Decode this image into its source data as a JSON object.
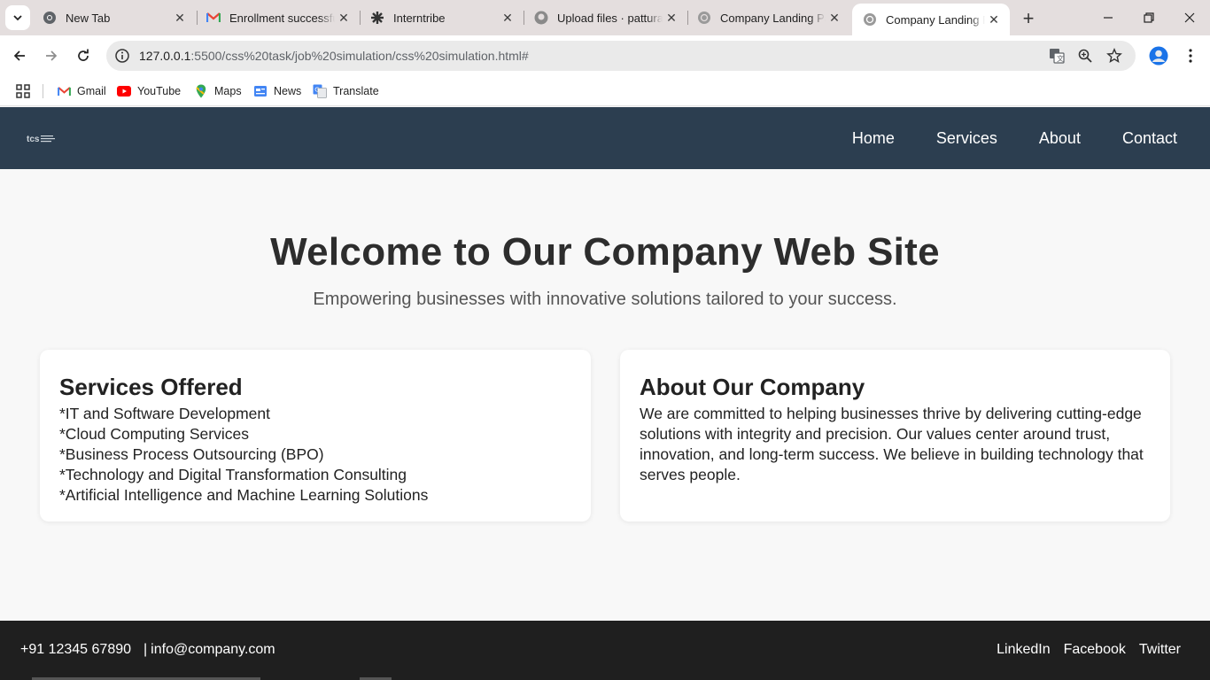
{
  "browser": {
    "tabs": [
      {
        "title": "New Tab",
        "icon": "chrome-icon"
      },
      {
        "title": "Enrollment successful",
        "icon": "gmail-icon"
      },
      {
        "title": "Interntribe",
        "icon": "interntribe-icon"
      },
      {
        "title": "Upload files · patturaj",
        "icon": "github-icon"
      },
      {
        "title": "Company Landing Page",
        "icon": "globe-icon"
      },
      {
        "title": "Company Landing Page",
        "icon": "globe-icon",
        "active": true
      }
    ],
    "url_host": "127.0.0.1",
    "url_rest": ":5500/css%20task/job%20simulation/css%20simulation.html#",
    "bookmarks": [
      {
        "label": "Gmail",
        "icon": "gmail-icon"
      },
      {
        "label": "YouTube",
        "icon": "youtube-icon"
      },
      {
        "label": "Maps",
        "icon": "maps-icon"
      },
      {
        "label": "News",
        "icon": "news-icon"
      },
      {
        "label": "Translate",
        "icon": "translate-icon"
      }
    ]
  },
  "header": {
    "nav": [
      "Home",
      "Services",
      "About",
      "Contact"
    ]
  },
  "hero": {
    "title": "Welcome to Our Company Web Site",
    "subtitle": "Empowering businesses with innovative solutions tailored to your success."
  },
  "services": {
    "heading": "Services Offered",
    "items": [
      "*IT and Software Development",
      "*Cloud Computing Services",
      "*Business Process Outsourcing (BPO)",
      "*Technology and Digital Transformation Consulting",
      "*Artificial Intelligence and Machine Learning Solutions"
    ]
  },
  "about": {
    "heading": "About Our Company",
    "text": "We are committed to helping businesses thrive by delivering cutting-edge solutions with integrity and precision. Our values center around trust, innovation, and long-term success. We believe in building technology that serves people."
  },
  "footer": {
    "phone": "+91 12345 67890",
    "separator": "|",
    "email": "info@company.com",
    "social": [
      "LinkedIn",
      "Facebook",
      "Twitter"
    ]
  },
  "colors": {
    "header_bg": "#2c3e50",
    "footer_bg": "#1f1f1f",
    "page_bg": "#f8f8f8"
  }
}
